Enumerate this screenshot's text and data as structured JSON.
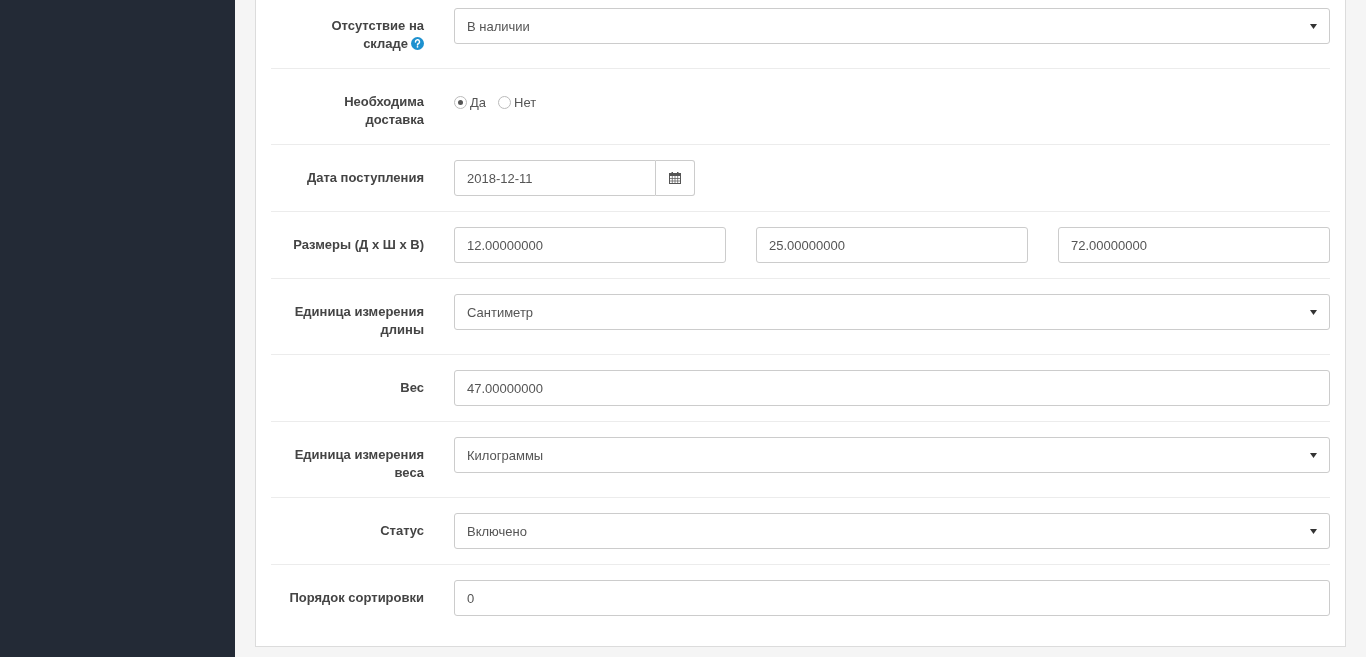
{
  "form": {
    "fields": [
      {
        "kind": "select",
        "label": "Отсутствие на складе",
        "help": true,
        "value": "В наличии"
      },
      {
        "kind": "radio",
        "label": "Необходима доставка",
        "options": [
          {
            "label": "Да",
            "selected": true
          },
          {
            "label": "Нет",
            "selected": false
          }
        ]
      },
      {
        "kind": "date",
        "label": "Дата поступления",
        "value": "2018-12-11"
      },
      {
        "kind": "multi",
        "label": "Размеры (Д х Ш х В)",
        "values": [
          "12.00000000",
          "25.00000000",
          "72.00000000"
        ]
      },
      {
        "kind": "select",
        "label": "Единица измерения длины",
        "value": "Сантиметр"
      },
      {
        "kind": "text",
        "label": "Вес",
        "value": "47.00000000"
      },
      {
        "kind": "select",
        "label": "Единица измерения веса",
        "value": "Килограммы"
      },
      {
        "kind": "select",
        "label": "Статус",
        "value": "Включено"
      },
      {
        "kind": "text",
        "label": "Порядок сортировки",
        "value": "0"
      }
    ]
  }
}
